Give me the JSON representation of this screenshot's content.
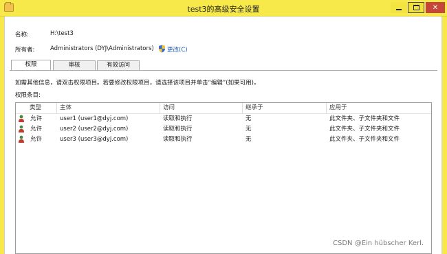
{
  "window": {
    "title": "test3的高级安全设置"
  },
  "info": {
    "name_label": "名称:",
    "name_value": "H:\\test3",
    "owner_label": "所有者:",
    "owner_value": "Administrators (DYJ\\Administrators)",
    "change_label": "更改(C)"
  },
  "tabs": [
    "权限",
    "审核",
    "有效访问"
  ],
  "hint": "如需其他信息，请双击权限项目。若要修改权限项目，请选择该项目并单击“编辑”(如果可用)。",
  "entries_label": "权限条目:",
  "table": {
    "columns": [
      "类型",
      "主体",
      "访问",
      "继承于",
      "应用于"
    ],
    "rows": [
      {
        "type": "允许",
        "principal": "user1 (user1@dyj.com)",
        "access": "读取和执行",
        "inherited": "无",
        "applies": "此文件夹、子文件夹和文件"
      },
      {
        "type": "允许",
        "principal": "user2 (user2@dyj.com)",
        "access": "读取和执行",
        "inherited": "无",
        "applies": "此文件夹、子文件夹和文件"
      },
      {
        "type": "允许",
        "principal": "user3 (user3@dyj.com)",
        "access": "读取和执行",
        "inherited": "无",
        "applies": "此文件夹、子文件夹和文件"
      }
    ]
  },
  "watermark": "CSDN @Ein hübscher Kerl.",
  "colors": {
    "titlebar": "#f7e94a",
    "close": "#c7463a",
    "link": "#1a56b8"
  }
}
